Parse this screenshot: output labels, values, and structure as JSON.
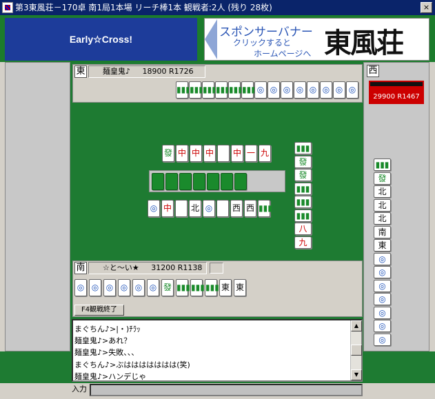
{
  "window": {
    "title": "第3東風荘－170卓 南1局1本場 リーチ棒1本 観戦者:2人 (残り 28枚)",
    "close": "×"
  },
  "banners": {
    "left": "Early☆Cross!",
    "right_line1": "スポンサーバナー",
    "right_line2": "クリックすると",
    "right_line3": "ホームページへ",
    "logo": "東風荘"
  },
  "players": {
    "north": {
      "seat": "東",
      "name": "麺皇鬼♪",
      "score": "18900",
      "rating": "R1726"
    },
    "west": {
      "seat": "西",
      "score": "29900",
      "rating": "R1467"
    },
    "south": {
      "seat": "南",
      "name": "☆と～い★",
      "score": "31200",
      "rating": "R1138"
    }
  },
  "tiles": {
    "north_hand": [
      "5s",
      "6s",
      "6s",
      "7s",
      "7s",
      "8s",
      "6p",
      "7p",
      "8p",
      "8p",
      "9p",
      "9p",
      "3p",
      "4p"
    ],
    "north_discards": [
      "発",
      "中",
      "中",
      "中",
      "",
      "中",
      "一萬",
      "九萬"
    ],
    "south_discards": [
      "9p",
      "中",
      "",
      "北",
      "9p",
      "",
      "西",
      "西",
      "8s"
    ],
    "east_discards": [
      "5s",
      "発",
      "発",
      "8s",
      "8s",
      "8s",
      "八萬",
      "九萬"
    ],
    "west_discards": [
      "6s",
      "発",
      "北",
      "北",
      "北",
      "南",
      "東",
      "5p",
      "6p",
      "7p",
      "5p",
      "6p",
      "6p",
      "3p"
    ],
    "south_hand": [
      "1p",
      "3p",
      "6p",
      "6p",
      "8p",
      "8p",
      "発",
      "4s",
      "5s",
      "9s",
      "東",
      "東"
    ]
  },
  "tile_glyphs": {
    "bamboo": "▮▮",
    "pin": "◎",
    "dragon_red": "中",
    "dragon_green": "發",
    "north": "北",
    "west": "西",
    "east": "東",
    "south": "南"
  },
  "controls": {
    "finish_button": "F4観戦終了",
    "input_label": "入力"
  },
  "chat": [
    "まぐちん♪>|・)ﾁﾗｯ",
    "麺皇鬼♪>あれ？",
    "麺皇鬼♪>失敗、、、",
    "まぐちん♪>ぶははははははは(笑)",
    "麺皇鬼♪>ハンデじゃ"
  ],
  "colors": {
    "felt": "#1e7b32",
    "banner_blue": "#1d3c9a",
    "title_bar": "#0a246a"
  }
}
